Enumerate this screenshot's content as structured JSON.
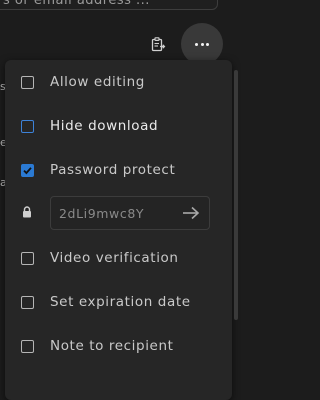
{
  "share": {
    "placeholder": "s or email address ..."
  },
  "toolbar": {
    "copy_icon": "clipboard-copy-icon",
    "more_icon": "more-horizontal-icon"
  },
  "background": {
    "fragments": [
      "s",
      "e",
      "a"
    ]
  },
  "menu": {
    "items": [
      {
        "label": "Allow editing",
        "checked": false
      },
      {
        "label": "Hide download",
        "checked": false,
        "focused": true
      },
      {
        "label": "Password protect",
        "checked": true
      },
      {
        "label": "Video verification",
        "checked": false
      },
      {
        "label": "Set expiration date",
        "checked": false
      },
      {
        "label": "Note to recipient",
        "checked": false
      }
    ],
    "password": {
      "value": "2dLi9mwc8Y",
      "lock_icon": "lock-icon",
      "submit_icon": "arrow-right-icon"
    }
  },
  "colors": {
    "accent": "#2b7ad3",
    "background": "#1c1c1c",
    "menu": "#262626"
  }
}
